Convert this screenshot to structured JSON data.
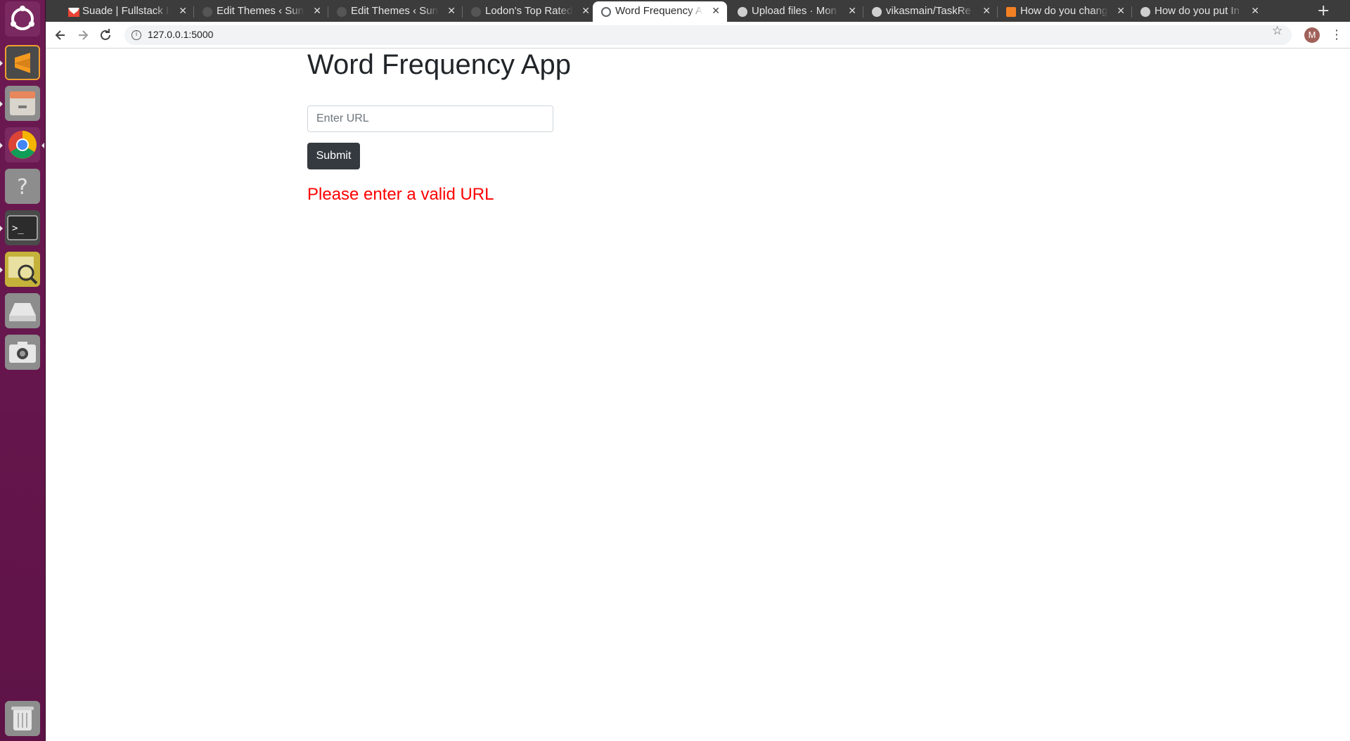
{
  "launcher": {
    "items": [
      {
        "name": "ubuntu-dash-icon"
      },
      {
        "name": "sublime-text-icon"
      },
      {
        "name": "file-manager-icon"
      },
      {
        "name": "chrome-icon"
      },
      {
        "name": "help-icon"
      },
      {
        "name": "terminal-icon"
      },
      {
        "name": "system-monitor-icon"
      },
      {
        "name": "disk-icon"
      },
      {
        "name": "camera-icon"
      },
      {
        "name": "trash-icon"
      }
    ]
  },
  "browser": {
    "tabs": [
      {
        "title": "Suade | Fullstack In",
        "favicon": "gmail-icon",
        "active": false
      },
      {
        "title": "Edit Themes ‹ Sunn",
        "favicon": "wordpress-icon",
        "active": false
      },
      {
        "title": "Edit Themes ‹ Sunn",
        "favicon": "wordpress-icon",
        "active": false
      },
      {
        "title": "Lodon's Top Rated",
        "favicon": "wordpress-icon",
        "active": false
      },
      {
        "title": "Word Frequency A",
        "favicon": "globe-icon",
        "active": true
      },
      {
        "title": "Upload files · Mon",
        "favicon": "github-icon",
        "active": false
      },
      {
        "title": "vikasmain/TaskRe",
        "favicon": "github-icon",
        "active": false
      },
      {
        "title": "How do you chang",
        "favicon": "stackoverflow-icon",
        "active": false
      },
      {
        "title": "How do you put In",
        "favicon": "github-icon",
        "active": false
      }
    ],
    "new_tab_label": "+",
    "close_label": "✕",
    "url": "127.0.0.1:5000",
    "profile_initial": "M"
  },
  "page": {
    "title": "Word Frequency App",
    "url_placeholder": "Enter URL",
    "url_value": "",
    "submit_label": "Submit",
    "error_message": "Please enter a valid URL"
  },
  "colors": {
    "launcher_bg": "#5e1347",
    "button_bg": "#343a40",
    "error": "#ff0000",
    "heading": "#212529"
  }
}
